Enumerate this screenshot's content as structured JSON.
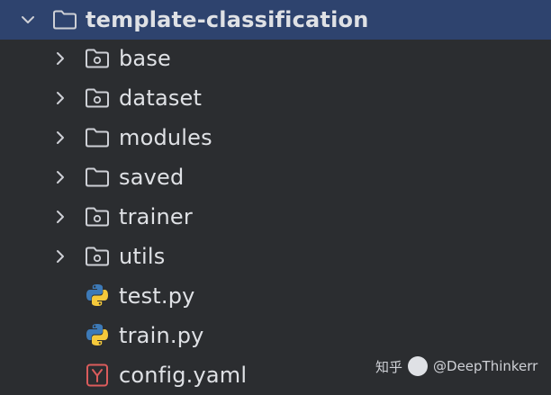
{
  "project_tree": {
    "root": {
      "label": "template-classification",
      "icon": "folder-icon",
      "expanded": true,
      "selected": true
    },
    "items": [
      {
        "label": "base",
        "icon": "package-folder-icon",
        "expandable": true
      },
      {
        "label": "dataset",
        "icon": "package-folder-icon",
        "expandable": true
      },
      {
        "label": "modules",
        "icon": "folder-icon",
        "expandable": true
      },
      {
        "label": "saved",
        "icon": "folder-icon",
        "expandable": true
      },
      {
        "label": "trainer",
        "icon": "package-folder-icon",
        "expandable": true
      },
      {
        "label": "utils",
        "icon": "package-folder-icon",
        "expandable": true
      },
      {
        "label": "test.py",
        "icon": "python-file-icon",
        "expandable": false
      },
      {
        "label": "train.py",
        "icon": "python-file-icon",
        "expandable": false
      },
      {
        "label": "config.yaml",
        "icon": "yaml-file-icon",
        "expandable": false
      }
    ]
  },
  "watermark": {
    "site": "知乎",
    "handle": "@DeepThinkerr"
  },
  "colors": {
    "background": "#2b2d30",
    "selection": "#2e436e",
    "text": "#dfe1e5",
    "icon_stroke": "#ced0d6",
    "python_blue": "#3d7ab8",
    "python_yellow": "#f5c93b",
    "yaml_red": "#db5c5c"
  }
}
